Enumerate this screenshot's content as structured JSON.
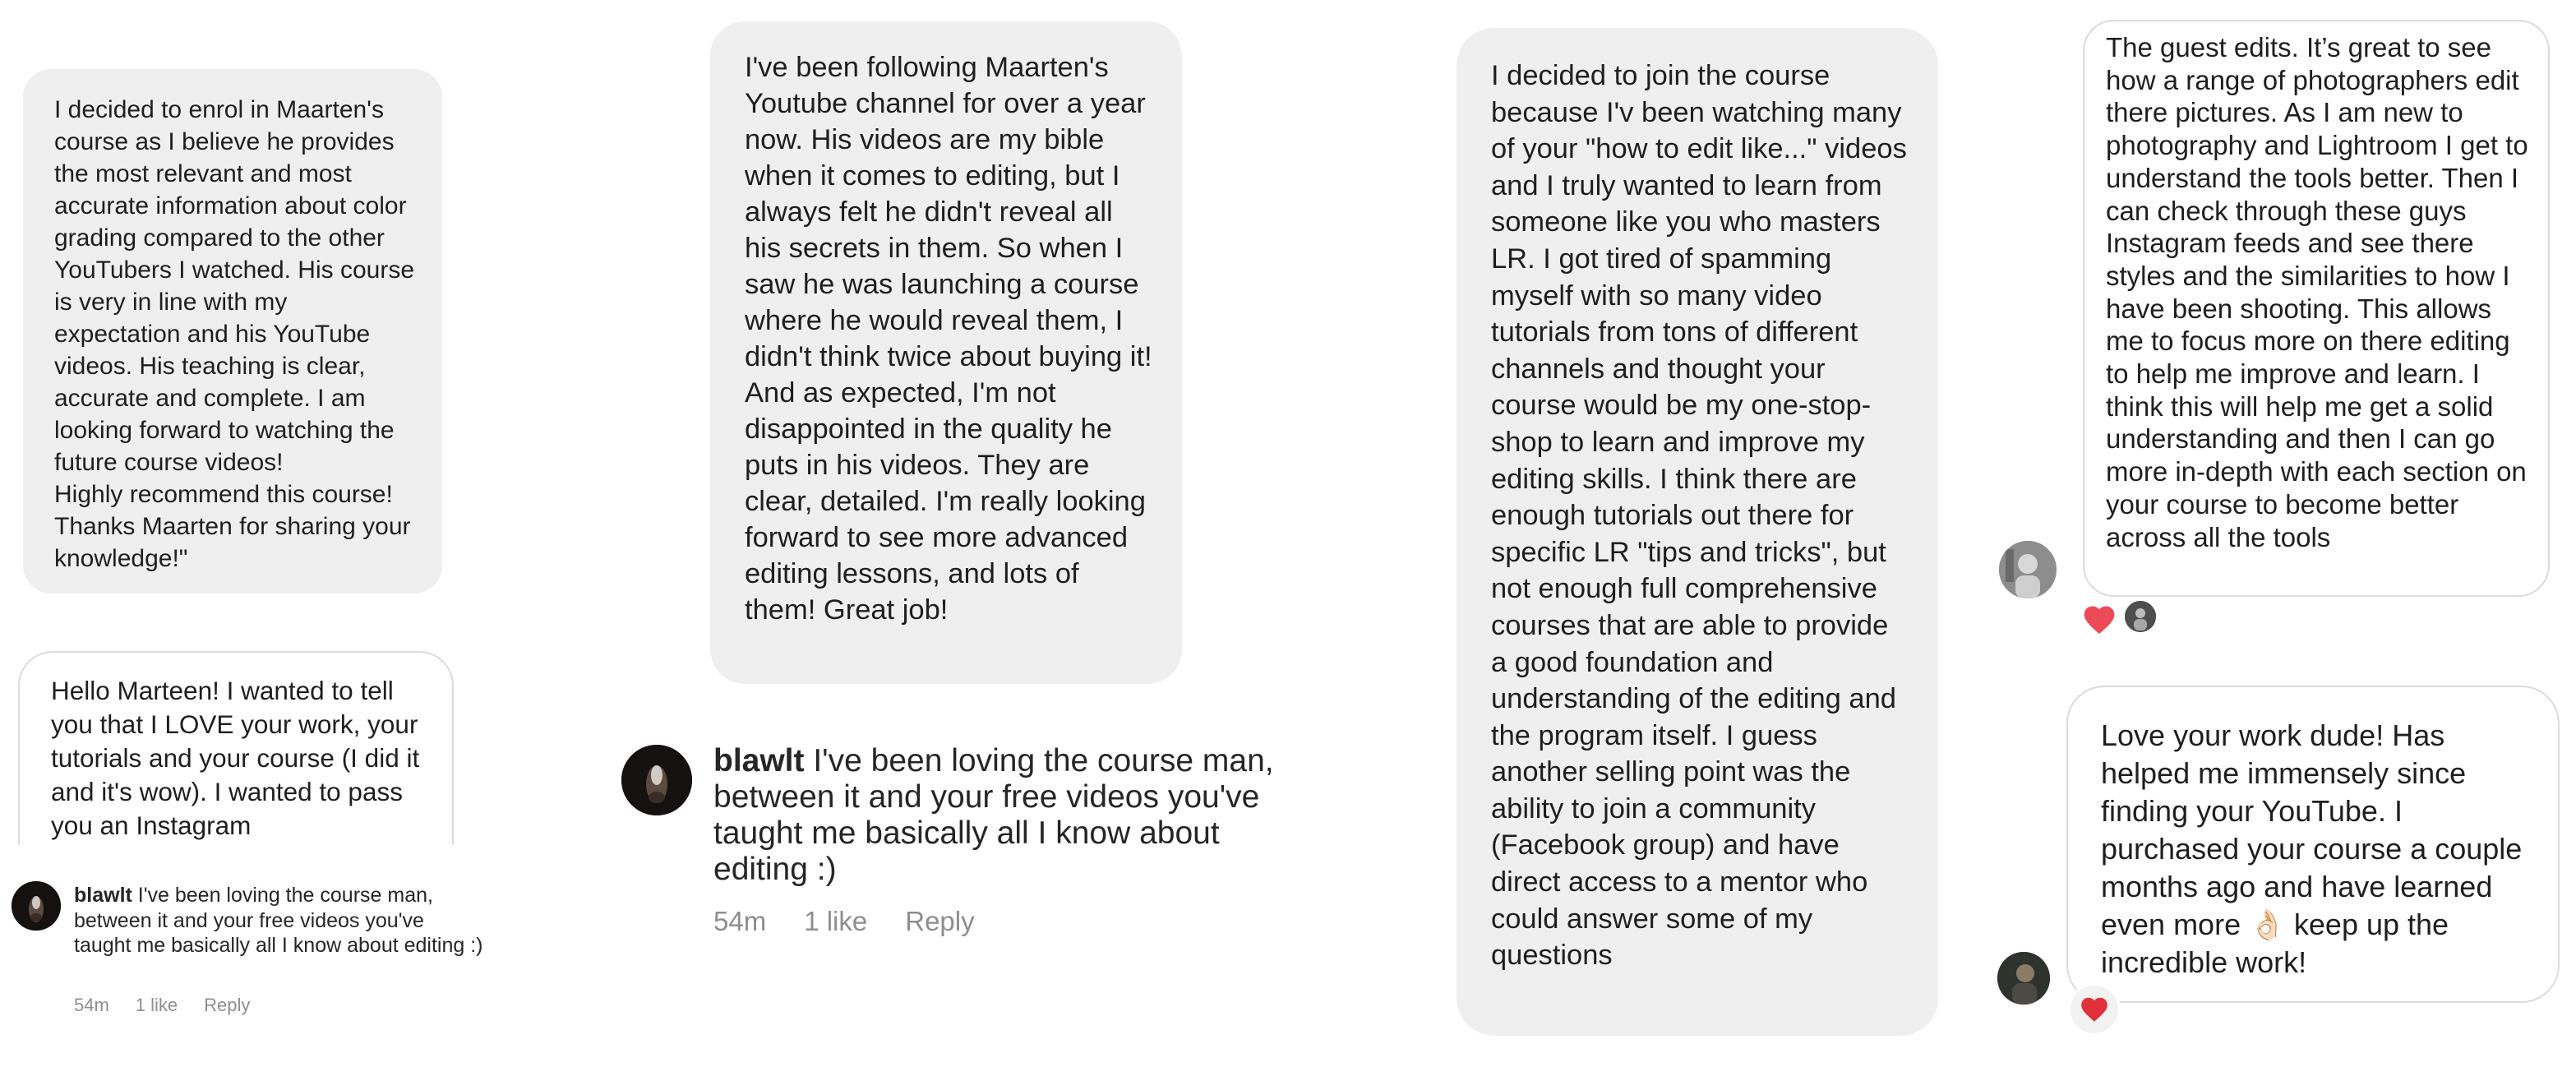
{
  "bubbles": {
    "b1": "I decided to enrol in Maarten's course as I believe he provides the most relevant and most accurate information about color grading compared to the other YouTubers I watched. His course is very in line with my expectation and his YouTube videos. His teaching is clear, accurate and complete. I am looking forward to watching the future course videos!\nHighly recommend this course! Thanks Maarten for sharing your knowledge!\"",
    "b2": "Hello Marteen! I wanted to tell you that I LOVE your work, your tutorials and your course (I did it and it's wow). I wanted to pass you an Instagram",
    "b3": "I've been following Maarten's Youtube channel for over a year now. His videos are my bible when it comes to editing, but I always felt he didn't reveal all his secrets in them. So when I saw he was launching a course where he would reveal them, I didn't think twice about buying it! And as expected, I'm not disappointed in the quality he puts in his videos. They are clear, detailed. I'm really looking forward to see more advanced editing lessons, and lots of them! Great job!",
    "b4": "I decided to join the course because I'v been watching many of your \"how to edit like...\" videos and I truly wanted to learn from someone like you who masters LR. I got tired of spamming myself with so many video tutorials from tons of different channels and thought your course would be my one-stop-shop to learn and improve my editing skills. I think there are enough tutorials out there for specific LR \"tips and tricks\", but not enough full comprehensive courses that are able to provide a good foundation and understanding of the editing and the program itself. I guess another selling point was the ability to join a community (Facebook group) and have direct access to a mentor who could answer some of my questions",
    "b5": "The guest edits. It’s great to see how a range of photographers edit there pictures. As I am new to photography and Lightroom I get to understand the tools better. Then I can check through these guys Instagram feeds and see there styles and the similarities to how I have been shooting. This allows me to focus more on there editing to help me improve and learn. I think this will help me get a solid understanding and then I can go more in-depth with each section on your course to become better across all the tools",
    "b6": "Love your work dude! Has helped me immensely since finding your YouTube. I purchased your course a couple months ago and have learned even more 👌🏻 keep up the incredible work!"
  },
  "comment_small": {
    "username": "blawlt",
    "text": " I've been loving the course man, between it and your free videos you've taught me basically all I know about editing :)",
    "time": "54m",
    "likes": "1 like",
    "reply": "Reply"
  },
  "comment_large": {
    "username": "blawlt",
    "text": " I've been loving the course man, between it and your free videos you've taught me basically all I know about editing :)",
    "time": "54m",
    "likes": "1 like",
    "reply": "Reply"
  },
  "colors": {
    "bubble_gray": "#efefef",
    "bubble_border": "#dbdbdb",
    "meta_gray": "#8e8e8e",
    "heart_red": "#ed4956"
  },
  "icons": {
    "reaction_b5": "heart-icon",
    "reaction_b6": "heart-icon"
  }
}
